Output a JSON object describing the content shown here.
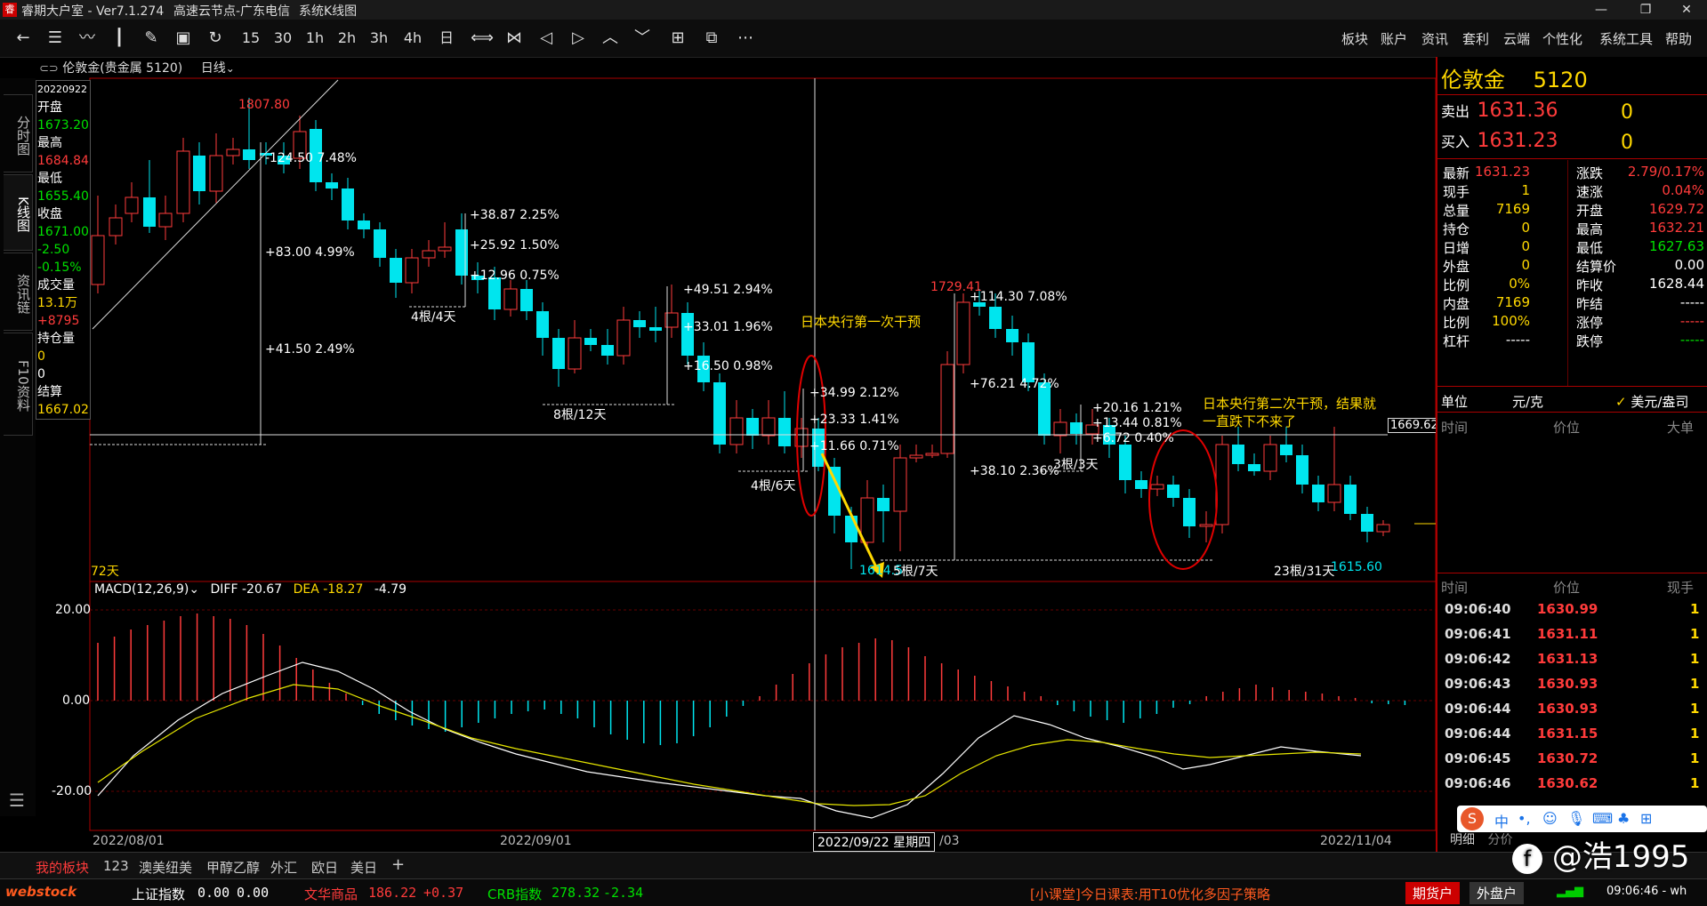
{
  "titlebar": {
    "app": "睿期大户室 - Ver7.1.274",
    "node": "高速云节点-广东电信",
    "view": "系统K线图"
  },
  "toolbar": {
    "icons": [
      "back-icon",
      "list-icon",
      "line-chart-icon",
      "kline-icon",
      "draw-icon",
      "save-icon",
      "refresh-icon"
    ],
    "periods": [
      "15",
      "30",
      "1h",
      "2h",
      "3h",
      "4h",
      "日"
    ],
    "menus": [
      "板块",
      "账户",
      "资讯",
      "套利",
      "云端",
      "个性化",
      "系统工具",
      "帮助"
    ]
  },
  "left_tabs": [
    "分时图",
    "K线图",
    "资讯链",
    "F10资料"
  ],
  "chart_header": {
    "symbol": "伦敦金(贵金属 5120)",
    "period": "日线"
  },
  "info_box": {
    "date": "20220922",
    "items": [
      {
        "label": "开盘",
        "value": "1673.20"
      },
      {
        "label": "最高",
        "value": "1684.84"
      },
      {
        "label": "最低",
        "value": "1655.40"
      },
      {
        "label": "收盘",
        "value": "1671.00"
      },
      {
        "label": "",
        "value": "-2.50"
      },
      {
        "label": "",
        "value": "-0.15%"
      },
      {
        "label": "成交量",
        "value": "13.1万"
      },
      {
        "label": "",
        "value": "+8795"
      },
      {
        "label": "持仓量",
        "value": "0"
      },
      {
        "label": "",
        "value": "0"
      },
      {
        "label": "结算",
        "value": "1667.02"
      }
    ]
  },
  "chart_labels": {
    "high_label": "1807.80",
    "high2_label": "1729.41",
    "low_label": "1614.5",
    "low2_label": "1615.60",
    "crosshair_price": "1669.62",
    "days_label": "72天",
    "annot1": "日本央行第一次干预",
    "annot2a": "日本央行第二次干预，结果就",
    "annot2b": "一直跌下不来了",
    "measure": [
      "-124.50  7.48%",
      "+83.00  4.99%",
      "+41.50  2.49%",
      "+38.87  2.25%",
      "+25.92  1.50%",
      "+12.96  0.75%",
      "4根/4天",
      "+49.51  2.94%",
      "+33.01  1.96%",
      "+16.50  0.98%",
      "8根/12天",
      "+34.99  2.12%",
      "+23.33  1.41%",
      "+11.66  0.71%",
      "4根/6天",
      "+114.30  7.08%",
      "+76.21  4.72%",
      "+38.10  2.36%",
      "5根/7天",
      "+20.16  1.21%",
      "+13.44  0.81%",
      "+6.72  0.40%",
      "3根/3天",
      "23根/31天"
    ]
  },
  "macd": {
    "title": "MACD(12,26,9)",
    "diff": "DIFF -20.67",
    "dea": "DEA -18.27",
    "macd": "-4.79",
    "ticks": [
      "20.00",
      "0.00",
      "-20.00"
    ]
  },
  "x_axis": [
    "2022/08/01",
    "2022/09/01",
    "2022/09/22 星期四",
    "/03",
    "2022/11/04"
  ],
  "quote": {
    "name": "伦敦金",
    "code": "5120",
    "sell_label": "卖出",
    "sell": "1631.36",
    "sell_qty": "0",
    "buy_label": "买入",
    "buy": "1631.23",
    "buy_qty": "0",
    "grid": [
      [
        "最新",
        "1631.23",
        "涨跌",
        "2.79/0.17%"
      ],
      [
        "现手",
        "1",
        "速涨",
        "0.04%"
      ],
      [
        "总量",
        "7169",
        "开盘",
        "1629.72"
      ],
      [
        "持仓",
        "0",
        "最高",
        "1632.21"
      ],
      [
        "日增",
        "0",
        "最低",
        "1627.63"
      ],
      [
        "外盘",
        "0",
        "结算价",
        "0.00"
      ],
      [
        "比例",
        "0%",
        "昨收",
        "1628.44"
      ],
      [
        "内盘",
        "7169",
        "昨结",
        "-----"
      ],
      [
        "比例",
        "100%",
        "涨停",
        "-----"
      ],
      [
        "杠杆",
        "-----",
        "跌停",
        "-----"
      ]
    ],
    "unit_label": "单位",
    "unit": "元/克",
    "unit2": "美元/盎司",
    "head1": [
      "时间",
      "价位",
      "大单"
    ],
    "head2": [
      "时间",
      "价位",
      "现手"
    ],
    "ticks": [
      [
        "09:06:40",
        "1630.99",
        "1"
      ],
      [
        "09:06:41",
        "1631.11",
        "1"
      ],
      [
        "09:06:42",
        "1631.13",
        "1"
      ],
      [
        "09:06:43",
        "1630.93",
        "1"
      ],
      [
        "09:06:44",
        "1630.93",
        "1"
      ],
      [
        "09:06:44",
        "1631.15",
        "1"
      ],
      [
        "09:06:45",
        "1630.72",
        "1"
      ],
      [
        "09:06:46",
        "1630.62",
        "1"
      ]
    ],
    "bottom_tabs": [
      "明细",
      "分价"
    ]
  },
  "bottom_tabs": [
    "我的板块",
    "123",
    "澳美纽美",
    "甲醇乙醇",
    "外汇",
    "欧日",
    "美日",
    "+"
  ],
  "status": {
    "logo": "webstock",
    "idx1_name": "上证指数",
    "idx1_val": "0.00",
    "idx1_chg": "0.00",
    "idx2_name": "文华商品",
    "idx2_val": "186.22",
    "idx2_chg": "+0.37",
    "idx3_name": "CRB指数",
    "idx3_val": "278.32",
    "idx3_chg": "-2.34",
    "news": "[小课堂]今日课表:用T10优化多因子策略",
    "btn1": "期货户",
    "btn2": "外盘户",
    "time": "09:06:46 - wh"
  },
  "watermark": "@浩1995",
  "colors": {
    "up": "#ff3b3b",
    "down": "#00e5ee",
    "border": "#aa0000",
    "yellow": "#ffd800"
  }
}
